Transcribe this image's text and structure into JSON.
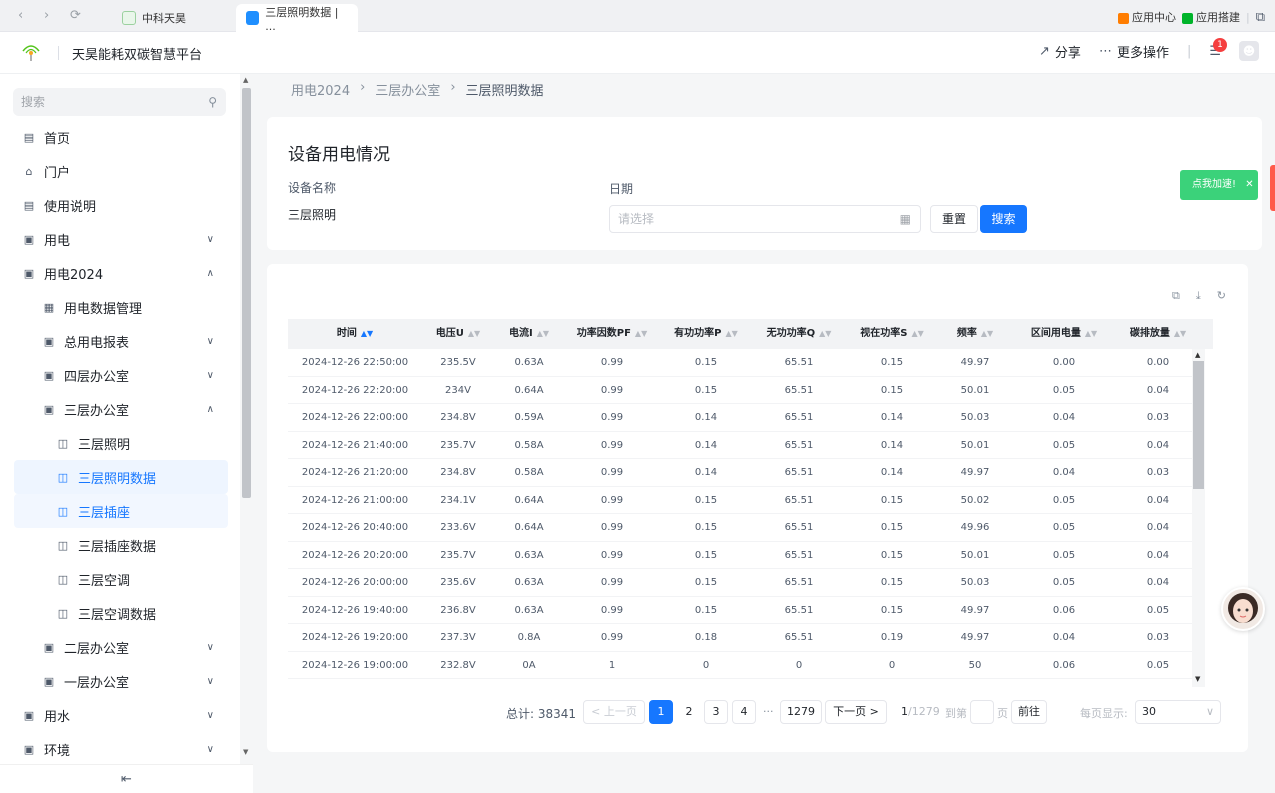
{
  "browser": {
    "tabs": [
      {
        "label": "中科天昊"
      },
      {
        "label": "三层照明数据 | ..."
      }
    ],
    "app_center": "应用中心",
    "app_build": "应用搭建"
  },
  "header": {
    "title": "天昊能耗双碳智慧平台",
    "share": "分享",
    "more": "更多操作",
    "notify_count": "1"
  },
  "sidebar": {
    "search_placeholder": "搜索",
    "items": [
      {
        "label": "首页"
      },
      {
        "label": "门户"
      },
      {
        "label": "使用说明"
      },
      {
        "label": "用电"
      },
      {
        "label": "用电2024"
      },
      {
        "label": "用电数据管理"
      },
      {
        "label": "总用电报表"
      },
      {
        "label": "四层办公室"
      },
      {
        "label": "三层办公室"
      },
      {
        "label": "三层照明"
      },
      {
        "label": "三层照明数据"
      },
      {
        "label": "三层插座"
      },
      {
        "label": "三层插座数据"
      },
      {
        "label": "三层空调"
      },
      {
        "label": "三层空调数据"
      },
      {
        "label": "二层办公室"
      },
      {
        "label": "一层办公室"
      },
      {
        "label": "用水"
      },
      {
        "label": "环境"
      }
    ]
  },
  "breadcrumb": [
    "用电2024",
    "三层办公室",
    "三层照明数据"
  ],
  "filter": {
    "title": "设备用电情况",
    "device_label": "设备名称",
    "device_value": "三层照明",
    "date_label": "日期",
    "date_placeholder": "请选择",
    "reset": "重置",
    "search": "搜索"
  },
  "table": {
    "columns": [
      "时间",
      "电压U",
      "电流I",
      "功率因数PF",
      "有功功率P",
      "无功功率Q",
      "视在功率S",
      "频率",
      "区间用电量",
      "碳排放量"
    ],
    "rows": [
      [
        "2024-12-26 22:50:00",
        "235.5V",
        "0.63A",
        "0.99",
        "0.15",
        "65.51",
        "0.15",
        "49.97",
        "0.00",
        "0.00"
      ],
      [
        "2024-12-26 22:20:00",
        "234V",
        "0.64A",
        "0.99",
        "0.15",
        "65.51",
        "0.15",
        "50.01",
        "0.05",
        "0.04"
      ],
      [
        "2024-12-26 22:00:00",
        "234.8V",
        "0.59A",
        "0.99",
        "0.14",
        "65.51",
        "0.14",
        "50.03",
        "0.04",
        "0.03"
      ],
      [
        "2024-12-26 21:40:00",
        "235.7V",
        "0.58A",
        "0.99",
        "0.14",
        "65.51",
        "0.14",
        "50.01",
        "0.05",
        "0.04"
      ],
      [
        "2024-12-26 21:20:00",
        "234.8V",
        "0.58A",
        "0.99",
        "0.14",
        "65.51",
        "0.14",
        "49.97",
        "0.04",
        "0.03"
      ],
      [
        "2024-12-26 21:00:00",
        "234.1V",
        "0.64A",
        "0.99",
        "0.15",
        "65.51",
        "0.15",
        "50.02",
        "0.05",
        "0.04"
      ],
      [
        "2024-12-26 20:40:00",
        "233.6V",
        "0.64A",
        "0.99",
        "0.15",
        "65.51",
        "0.15",
        "49.96",
        "0.05",
        "0.04"
      ],
      [
        "2024-12-26 20:20:00",
        "235.7V",
        "0.63A",
        "0.99",
        "0.15",
        "65.51",
        "0.15",
        "50.01",
        "0.05",
        "0.04"
      ],
      [
        "2024-12-26 20:00:00",
        "235.6V",
        "0.63A",
        "0.99",
        "0.15",
        "65.51",
        "0.15",
        "50.03",
        "0.05",
        "0.04"
      ],
      [
        "2024-12-26 19:40:00",
        "236.8V",
        "0.63A",
        "0.99",
        "0.15",
        "65.51",
        "0.15",
        "49.97",
        "0.06",
        "0.05"
      ],
      [
        "2024-12-26 19:20:00",
        "237.3V",
        "0.8A",
        "0.99",
        "0.18",
        "65.51",
        "0.19",
        "49.97",
        "0.04",
        "0.03"
      ],
      [
        "2024-12-26 19:00:00",
        "232.8V",
        "0A",
        "1",
        "0",
        "0",
        "0",
        "50",
        "0.06",
        "0.05"
      ]
    ]
  },
  "pager": {
    "total": "总计: 38341",
    "prev": "< 上一页",
    "pages": [
      "1",
      "2",
      "3",
      "4"
    ],
    "ellipsis": "···",
    "last": "1279",
    "next": "下一页 >",
    "current": "1",
    "page_count": "/1279",
    "goto_label": "到第",
    "page_unit": "页",
    "goto_btn": "前往",
    "per_page_label": "每页显示:",
    "per_page": "30"
  },
  "float": {
    "accelerate": "点我加速!"
  },
  "colors": {
    "primary": "#1677ff",
    "accent_green": "#3bd27a",
    "badge_red": "#f53f3f"
  }
}
